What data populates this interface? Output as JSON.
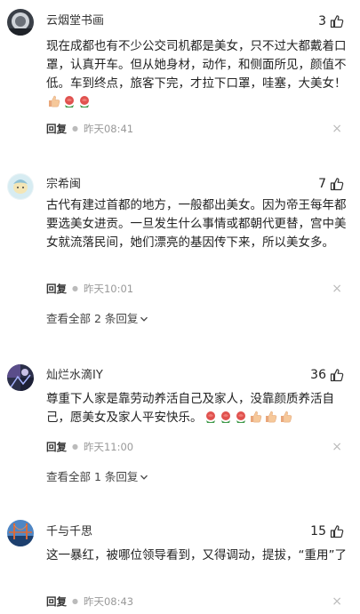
{
  "comments": [
    {
      "username": "云烟堂书画",
      "likes": "3",
      "text": "现在成都也有不少公交司机都是美女，只不过大都戴着口罩，认真开车。但从她身材，动作，和侧面所见，颜值不低。车到终点，旅客下完，才拉下口罩，哇塞，大美女！",
      "reply_label": "回复",
      "timestamp": "昨天08:41"
    },
    {
      "username": "宗希闽",
      "likes": "7",
      "text": "古代有建过首都的地方，一般都出美女。因为帝王每年都要选美女进贡。一旦发生什么事情或都朝代更替，宫中美女就流落民间，她们漂亮的基因传下来，所以美女多。",
      "reply_label": "回复",
      "timestamp": "昨天10:01",
      "view_all": "查看全部 2 条回复"
    },
    {
      "username": "灿烂水滴IY",
      "likes": "36",
      "text": "尊重下人家是靠劳动养活自己及家人，没靠颜质养活自己，愿美女及家人平安快乐。",
      "reply_label": "回复",
      "timestamp": "昨天11:00",
      "view_all": "查看全部 1 条回复"
    },
    {
      "username": "千与千思",
      "likes": "15",
      "text": "这一暴红，被哪位领导看到，又得调动，提拔，“重用”了",
      "reply_label": "回复",
      "timestamp": "昨天08:43"
    }
  ],
  "icons": {
    "like": "thumbs-up-icon",
    "close": "close-icon",
    "expand": "chevron-down-icon",
    "emoji_thumb": "thumbs-up-emoji-icon",
    "emoji_rose": "rose-emoji-icon"
  },
  "colors": {
    "text": "#222222",
    "meta": "#999999",
    "rose": "#e0524f",
    "leaf": "#3f9a4a",
    "thumb": "#f6c89a"
  }
}
